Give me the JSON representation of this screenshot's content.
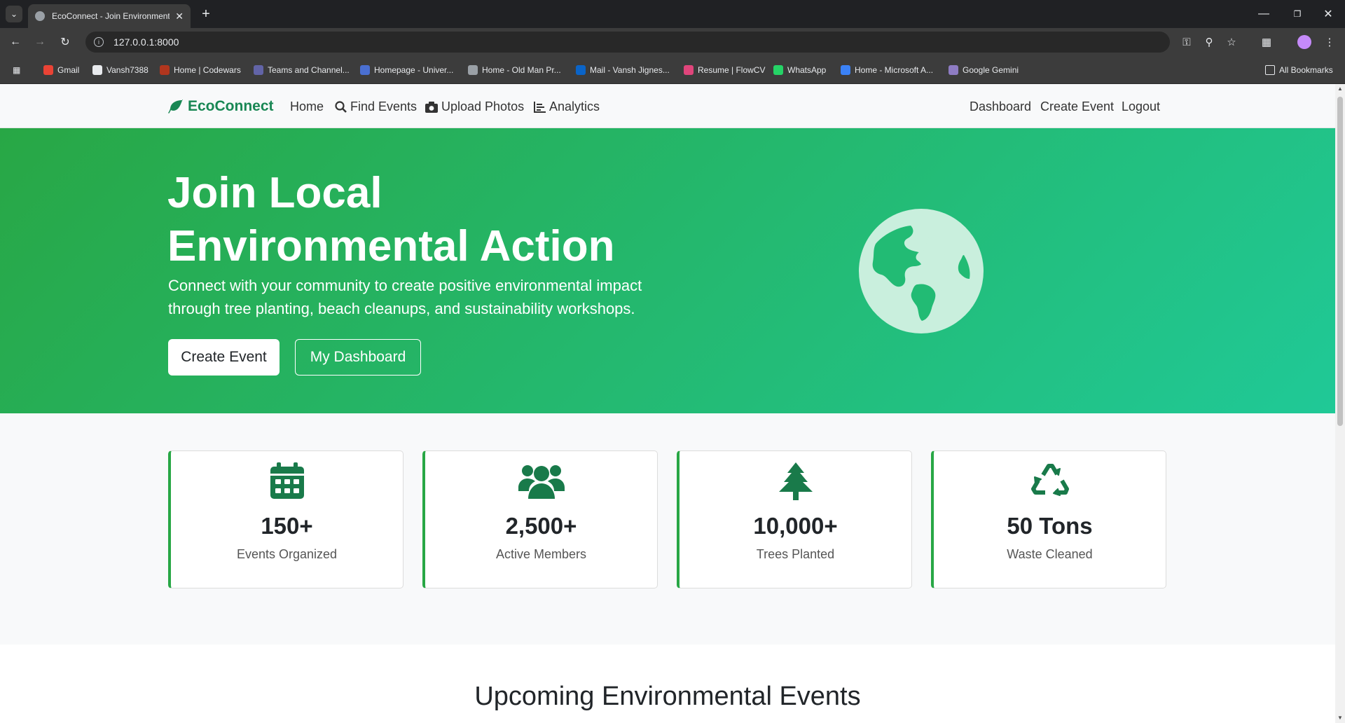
{
  "browser": {
    "tab_title": "EcoConnect - Join Environment",
    "url": "127.0.0.1:8000",
    "bookmarks": [
      {
        "label": "Gmail",
        "color": "#ea4335"
      },
      {
        "label": "Vansh7388",
        "color": "#e8eaed"
      },
      {
        "label": "Home | Codewars",
        "color": "#b1361e"
      },
      {
        "label": "Teams and Channel...",
        "color": "#6264a7"
      },
      {
        "label": "Homepage - Univer...",
        "color": "#4a6fd1"
      },
      {
        "label": "Home - Old Man Pr...",
        "color": "#9aa0a6"
      },
      {
        "label": "Mail - Vansh Jignes...",
        "color": "#0a64c8"
      },
      {
        "label": "Resume | FlowCV",
        "color": "#e0457b"
      },
      {
        "label": "WhatsApp",
        "color": "#25d366"
      },
      {
        "label": "Home - Microsoft A...",
        "color": "#3b82f6"
      },
      {
        "label": "Google Gemini",
        "color": "#8e7cc3"
      }
    ],
    "all_bookmarks": "All Bookmarks"
  },
  "navbar": {
    "brand": "EcoConnect",
    "links": {
      "home": "Home",
      "find_events": "Find Events",
      "upload_photos": "Upload Photos",
      "analytics": "Analytics",
      "dashboard": "Dashboard",
      "create_event": "Create Event",
      "logout": "Logout"
    }
  },
  "hero": {
    "title_line1": "Join Local",
    "title_line2": "Environmental Action",
    "subtitle_line1": "Connect with your community to create positive environmental impact",
    "subtitle_line2": "through tree planting, beach cleanups, and sustainability workshops.",
    "primary_button": "Create Event",
    "secondary_button": "My Dashboard"
  },
  "stats": [
    {
      "icon": "calendar-icon",
      "value": "150+",
      "label": "Events Organized"
    },
    {
      "icon": "users-icon",
      "value": "2,500+",
      "label": "Active Members"
    },
    {
      "icon": "tree-icon",
      "value": "10,000+",
      "label": "Trees Planted"
    },
    {
      "icon": "recycle-icon",
      "value": "50 Tons",
      "label": "Waste Cleaned"
    }
  ],
  "upcoming_title": "Upcoming Environmental Events",
  "colors": {
    "accent": "#198754",
    "hero_start": "#28a745",
    "hero_end": "#20c997",
    "icon": "#197a4a"
  }
}
